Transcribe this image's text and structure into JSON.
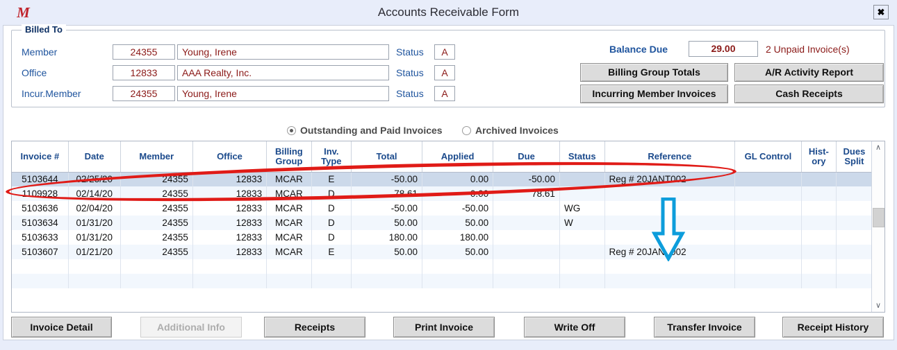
{
  "window": {
    "title": "Accounts Receivable Form",
    "logo": "m-logo-icon",
    "close_label": "✖"
  },
  "billed_to": {
    "legend": "Billed To",
    "status_label": "Status",
    "rows": [
      {
        "label": "Member",
        "id": "24355",
        "name": "Young, Irene",
        "status": "A"
      },
      {
        "label": "Office",
        "id": "12833",
        "name": "AAA Realty, Inc.",
        "status": "A"
      },
      {
        "label": "Incur.Member",
        "id": "24355",
        "name": "Young, Irene",
        "status": "A"
      }
    ]
  },
  "summary": {
    "balance_label": "Balance Due",
    "balance_value": "29.00",
    "unpaid_text": "2  Unpaid Invoice(s)",
    "buttons": [
      "Billing Group Totals",
      "A/R Activity Report",
      "Incurring Member Invoices",
      "Cash Receipts"
    ]
  },
  "filter": {
    "options": [
      {
        "label": "Outstanding and Paid Invoices",
        "selected": true
      },
      {
        "label": "Archived Invoices",
        "selected": false
      }
    ]
  },
  "grid": {
    "columns": [
      "Invoice #",
      "Date",
      "Member",
      "Office",
      "Billing Group",
      "Inv. Type",
      "Total",
      "Applied",
      "Due",
      "Status",
      "Reference",
      "GL Control",
      "Hist- ory",
      "Dues Split"
    ],
    "rows": [
      {
        "invoice": "5103644",
        "date": "02/25/20",
        "member": "24355",
        "office": "12833",
        "billing_group": "MCAR",
        "inv_type": "E",
        "total": "-50.00",
        "applied": "0.00",
        "due": "-50.00",
        "status": "",
        "reference": "Reg # 20JANT002",
        "gl_control": "",
        "history": "",
        "dues_split": "",
        "selected": true
      },
      {
        "invoice": "1109928",
        "date": "02/14/20",
        "member": "24355",
        "office": "12833",
        "billing_group": "MCAR",
        "inv_type": "D",
        "total": "78.61",
        "applied": "0.00",
        "due": "78.61",
        "status": "",
        "reference": "",
        "gl_control": "",
        "history": "",
        "dues_split": "",
        "selected": false
      },
      {
        "invoice": "5103636",
        "date": "02/04/20",
        "member": "24355",
        "office": "12833",
        "billing_group": "MCAR",
        "inv_type": "D",
        "total": "-50.00",
        "applied": "-50.00",
        "due": "",
        "status": "WG",
        "reference": "",
        "gl_control": "",
        "history": "",
        "dues_split": "",
        "selected": false
      },
      {
        "invoice": "5103634",
        "date": "01/31/20",
        "member": "24355",
        "office": "12833",
        "billing_group": "MCAR",
        "inv_type": "D",
        "total": "50.00",
        "applied": "50.00",
        "due": "",
        "status": "W",
        "reference": "",
        "gl_control": "",
        "history": "",
        "dues_split": "",
        "selected": false
      },
      {
        "invoice": "5103633",
        "date": "01/31/20",
        "member": "24355",
        "office": "12833",
        "billing_group": "MCAR",
        "inv_type": "D",
        "total": "180.00",
        "applied": "180.00",
        "due": "",
        "status": "",
        "reference": "",
        "gl_control": "",
        "history": "",
        "dues_split": "",
        "selected": false
      },
      {
        "invoice": "5103607",
        "date": "01/21/20",
        "member": "24355",
        "office": "12833",
        "billing_group": "MCAR",
        "inv_type": "E",
        "total": "50.00",
        "applied": "50.00",
        "due": "",
        "status": "",
        "reference": "Reg # 20JANT002",
        "gl_control": "",
        "history": "",
        "dues_split": "",
        "selected": false
      },
      {
        "invoice": "",
        "date": "",
        "member": "",
        "office": "",
        "billing_group": "",
        "inv_type": "",
        "total": "",
        "applied": "",
        "due": "",
        "status": "",
        "reference": "",
        "gl_control": "",
        "history": "",
        "dues_split": "",
        "selected": false
      },
      {
        "invoice": "",
        "date": "",
        "member": "",
        "office": "",
        "billing_group": "",
        "inv_type": "",
        "total": "",
        "applied": "",
        "due": "",
        "status": "",
        "reference": "",
        "gl_control": "",
        "history": "",
        "dues_split": "",
        "selected": false
      }
    ],
    "scrollbar": {
      "up": "∧",
      "down": "∨"
    }
  },
  "actions": [
    {
      "label": "Invoice Detail",
      "enabled": true
    },
    {
      "label": "Additional Info",
      "enabled": false
    },
    {
      "label": "Receipts",
      "enabled": true
    },
    {
      "label": "Print Invoice",
      "enabled": true
    },
    {
      "label": "Write Off",
      "enabled": true
    },
    {
      "label": "Transfer Invoice",
      "enabled": true
    },
    {
      "label": "Receipt History",
      "enabled": true
    }
  ],
  "annotations": {
    "ellipse_color": "#e01b17",
    "arrow_color": "#0d9ddb",
    "ellipse_target": "selected-invoice-row",
    "arrow_target": "reference-column"
  },
  "colors": {
    "label_blue": "#20559e",
    "value_red": "#8b1a18",
    "header_blue": "#1b4a8c",
    "selection": "#ccd9ea",
    "titlebar": "#e8edfa"
  }
}
